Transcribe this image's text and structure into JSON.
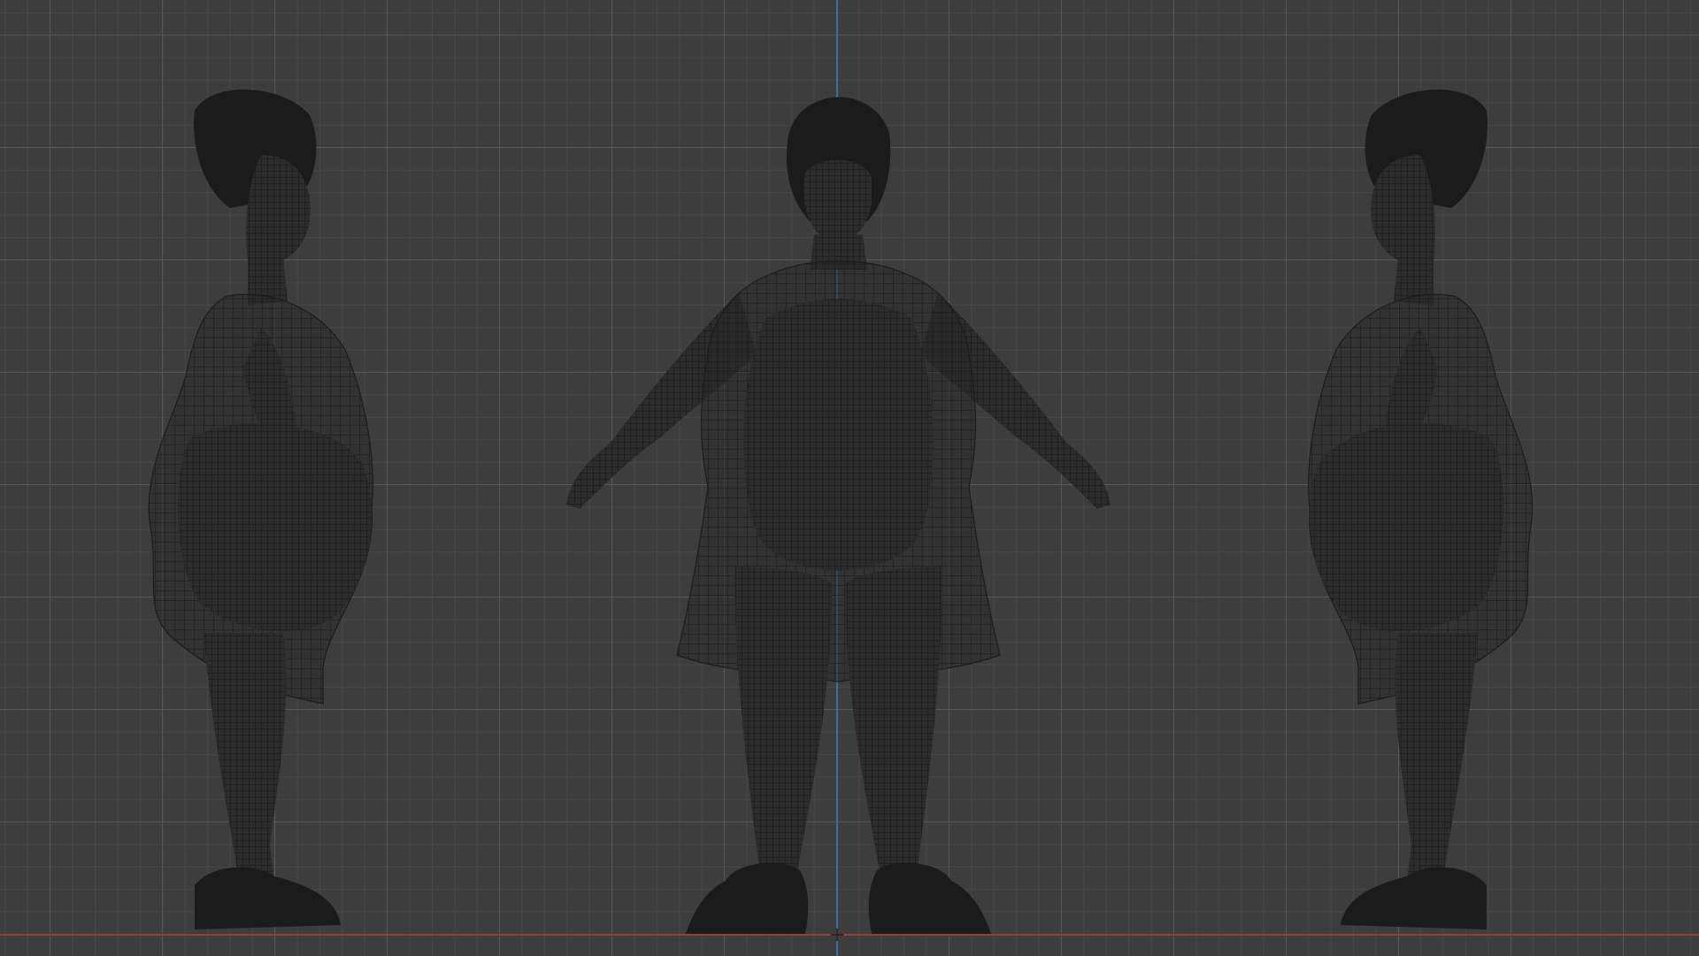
{
  "viewport": {
    "mode": "wireframe-orthographic",
    "colors": {
      "background": "#3d3d3d",
      "grid_major": "#5a5a5a",
      "grid_minor": "#484848",
      "z_axis": "#3b6ea5",
      "x_axis": "#9c3b3b",
      "mesh": "#1a1a1a"
    }
  },
  "figures": [
    {
      "view": "left-side",
      "icon": "character-side-left"
    },
    {
      "view": "front",
      "icon": "character-front"
    },
    {
      "view": "right-side",
      "icon": "character-side-right"
    }
  ]
}
